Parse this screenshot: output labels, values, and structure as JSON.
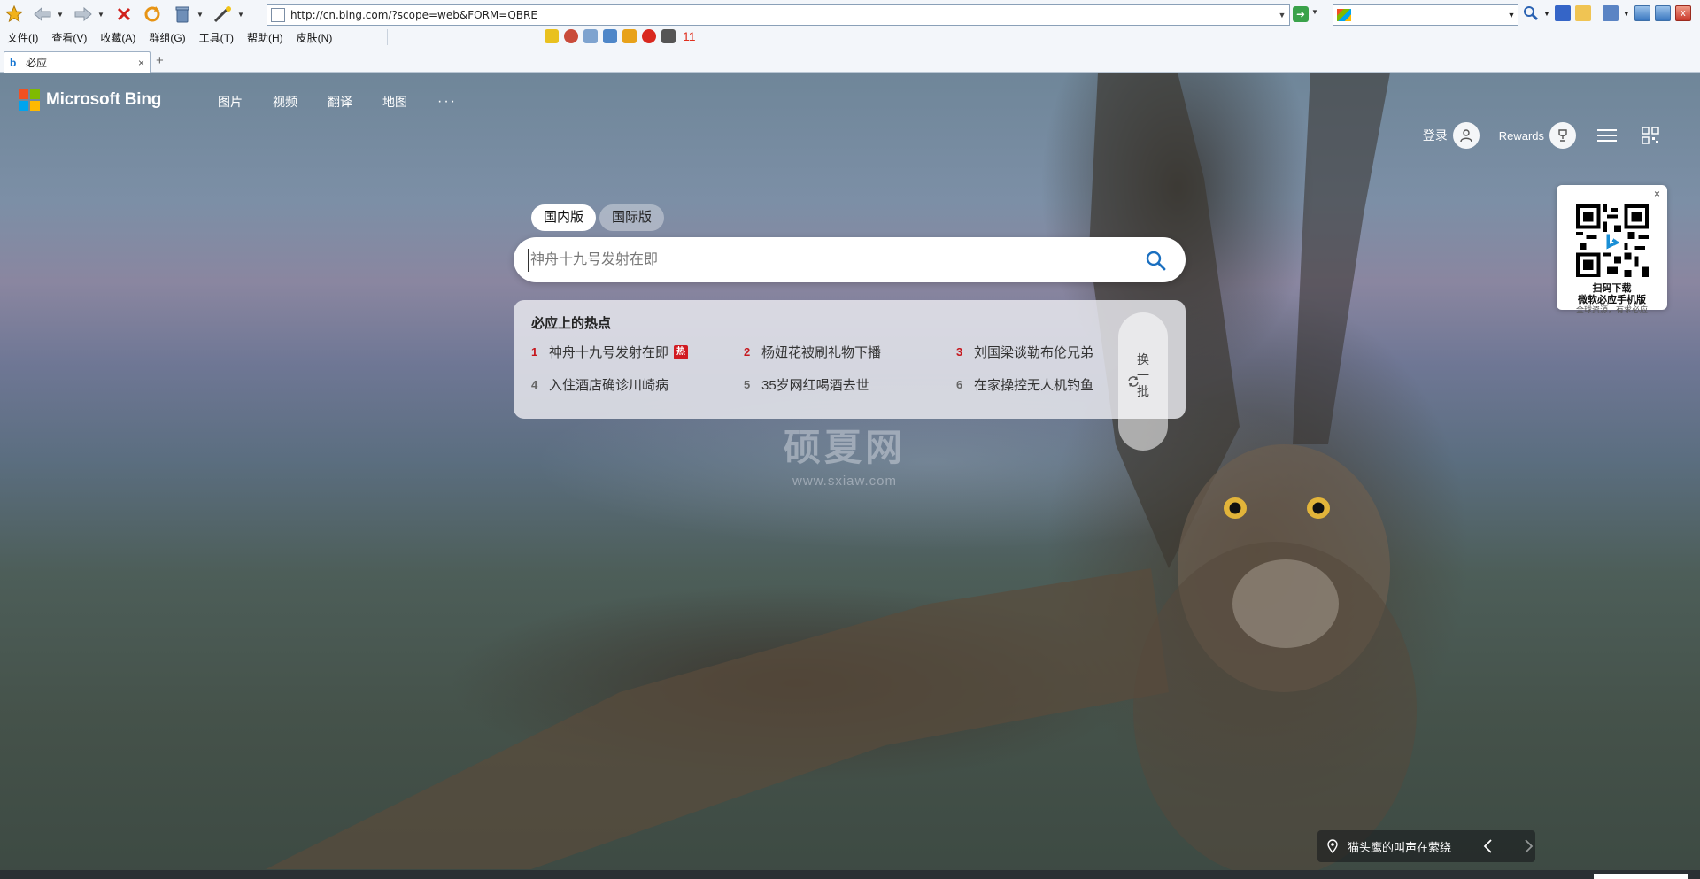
{
  "browser": {
    "url": "http://cn.bing.com/?scope=web&FORM=QBRE",
    "menus": [
      "文件(I)",
      "查看(V)",
      "收藏(A)",
      "群组(G)",
      "工具(T)",
      "帮助(H)",
      "皮肤(N)"
    ],
    "fav_count": "11",
    "tab_title": "必应",
    "tab_close": "×",
    "new_tab": "+"
  },
  "header": {
    "logo": "Microsoft Bing",
    "nav": [
      "图片",
      "视频",
      "翻译",
      "地图"
    ],
    "more": "···",
    "signin": "登录",
    "rewards": "Rewards"
  },
  "qr": {
    "close": "×",
    "line1": "扫码下载",
    "line2": "微软必应手机版",
    "line3": "全球资源，有求必应"
  },
  "search": {
    "scope_domestic": "国内版",
    "scope_intl": "国际版",
    "placeholder": "神舟十九号发射在即"
  },
  "trending": {
    "title": "必应上的热点",
    "hot_badge": "热",
    "items": [
      {
        "num": "1",
        "text": "神舟十九号发射在即"
      },
      {
        "num": "2",
        "text": "杨妞花被刷礼物下播"
      },
      {
        "num": "3",
        "text": "刘国梁谈勒布伦兄弟"
      },
      {
        "num": "4",
        "text": "入住酒店确诊川崎病"
      },
      {
        "num": "5",
        "text": "35岁网红喝酒去世"
      },
      {
        "num": "6",
        "text": "在家操控无人机钓鱼"
      }
    ],
    "refresh": [
      "换",
      "一",
      "批"
    ]
  },
  "watermark": {
    "title": "硕夏网",
    "url": "www.sxiaw.com"
  },
  "caption": {
    "text": "猫头鹰的叫声在萦绕"
  },
  "colors": {
    "hot_red": "#c6171d",
    "ms_red": "#f25022",
    "ms_green": "#7fba00",
    "ms_blue": "#00a4ef",
    "ms_yellow": "#ffb900",
    "search_blue": "#1a6fc0"
  },
  "icons": [
    "favorite-star-icon",
    "back-icon",
    "forward-icon",
    "stop-icon",
    "refresh-icon",
    "trash-icon",
    "wand-icon",
    "search-icon",
    "qr-code-icon",
    "user-icon",
    "rewards-trophy-icon",
    "hamburger-menu-icon",
    "location-pin-icon",
    "chevron-left-icon",
    "chevron-right-icon"
  ]
}
